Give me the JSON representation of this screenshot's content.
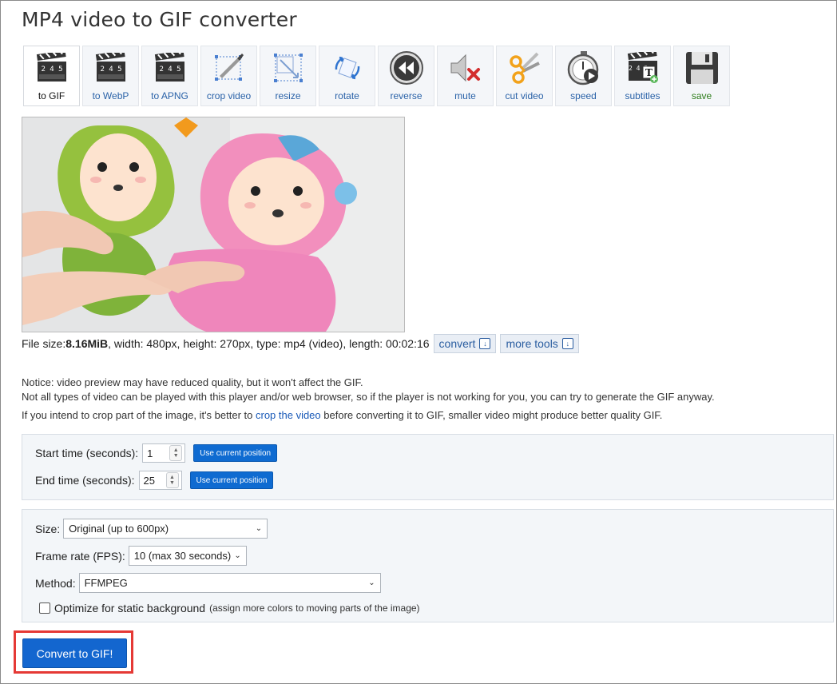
{
  "page": {
    "title": "MP4 video to GIF converter"
  },
  "toolbar": {
    "items": [
      {
        "label": "to GIF",
        "icon": "clapperboard-icon"
      },
      {
        "label": "to WebP",
        "icon": "clapperboard-icon"
      },
      {
        "label": "to APNG",
        "icon": "clapperboard-icon"
      },
      {
        "label": "crop video",
        "icon": "crop-icon"
      },
      {
        "label": "resize",
        "icon": "resize-icon"
      },
      {
        "label": "rotate",
        "icon": "rotate-icon"
      },
      {
        "label": "reverse",
        "icon": "rewind-icon"
      },
      {
        "label": "mute",
        "icon": "speaker-mute-icon"
      },
      {
        "label": "cut video",
        "icon": "scissors-icon"
      },
      {
        "label": "speed",
        "icon": "stopwatch-icon"
      },
      {
        "label": "subtitles",
        "icon": "subtitles-icon"
      },
      {
        "label": "save",
        "icon": "floppy-disk-icon"
      }
    ],
    "clap_digits": "2 4 5"
  },
  "fileinfo": {
    "prefix": "File size: ",
    "size": "8.16MiB",
    "rest": ", width: 480px, height: 270px, type: mp4 (video), length: 00:02:16",
    "convert_label": "convert",
    "more_tools_label": "more tools"
  },
  "notice": {
    "line1": "Notice: video preview may have reduced quality, but it won't affect the GIF.",
    "line2": "Not all types of video can be played with this player and/or web browser, so if the player is not working for you, you can try to generate the GIF anyway.",
    "line3_pre": "If you intend to crop part of the image, it's better to ",
    "line3_link": "crop the video",
    "line3_post": " before converting it to GIF, smaller video might produce better quality GIF."
  },
  "time": {
    "start_label": "Start time (seconds):",
    "start_value": "1",
    "end_label": "End time (seconds):",
    "end_value": "25",
    "use_current": "Use current position"
  },
  "options": {
    "size_label": "Size:",
    "size_value": "Original (up to 600px)",
    "fps_label": "Frame rate (FPS):",
    "fps_value": "10 (max 30 seconds)",
    "method_label": "Method:",
    "method_value": "FFMPEG",
    "optimize_label": "Optimize for static background",
    "optimize_note": "(assign more colors to moving parts of the image)"
  },
  "convert": {
    "label": "Convert to GIF!"
  },
  "colors": {
    "accent": "#1366cf",
    "highlight": "#e53935",
    "link": "#2a62a8"
  }
}
